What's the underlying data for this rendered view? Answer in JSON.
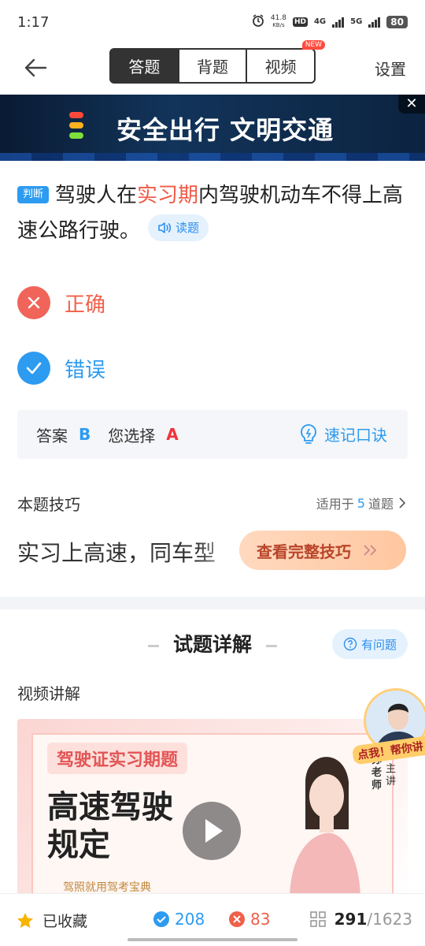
{
  "status_bar": {
    "time": "1:17",
    "speed_value": "41.8",
    "speed_unit": "KB/s",
    "hd": "HD",
    "network1": "4G",
    "network2": "5G",
    "battery": "80"
  },
  "nav": {
    "tabs": [
      {
        "label": "答题",
        "active": true
      },
      {
        "label": "背题",
        "active": false
      },
      {
        "label": "视频",
        "active": false
      }
    ],
    "new_badge": "NEW",
    "settings_label": "设置"
  },
  "banner": {
    "text": "安全出行  文明交通",
    "close": "✕",
    "light_colors": [
      "#ff4a3a",
      "#ffb020",
      "#7ee03a"
    ]
  },
  "question": {
    "type_tag": "判断",
    "text_before": "驾驶人在",
    "text_highlight": "实习期",
    "text_after": "内驾驶机动车不得上高速公路行驶。",
    "read_button": "读题"
  },
  "options": [
    {
      "label": "正确",
      "state": "wrong-selected",
      "icon": "close-icon"
    },
    {
      "label": "错误",
      "state": "correct",
      "icon": "check-icon"
    }
  ],
  "answer": {
    "answer_label": "答案",
    "answer_value": "B",
    "your_choice_label": "您选择",
    "your_choice_value": "A",
    "memo_label": "速记口诀"
  },
  "tips": {
    "title": "本题技巧",
    "apply_prefix": "适用于",
    "apply_count": "5",
    "apply_suffix": "道题",
    "content": "实习上高速，同车型",
    "button": "查看完整技巧"
  },
  "detail": {
    "title": "试题详解",
    "ask_button": "有问题",
    "video_section_title": "视频讲解",
    "video_tag": "驾驶证实习期题",
    "video_headline_1": "高速驾驶",
    "video_headline_2": "规定",
    "teacher_name": "苏老师",
    "teacher_role": "主讲",
    "video_subtitle": "驾照就用驾考宝典",
    "float_label": "点我！帮你讲"
  },
  "bottom_bar": {
    "favorite_label": "已收藏",
    "correct_count": "208",
    "wrong_count": "83",
    "current": "291",
    "total": "/1623"
  },
  "colors": {
    "accent_blue": "#2d9bf0",
    "error_red": "#f0604a",
    "dark": "#333333"
  }
}
